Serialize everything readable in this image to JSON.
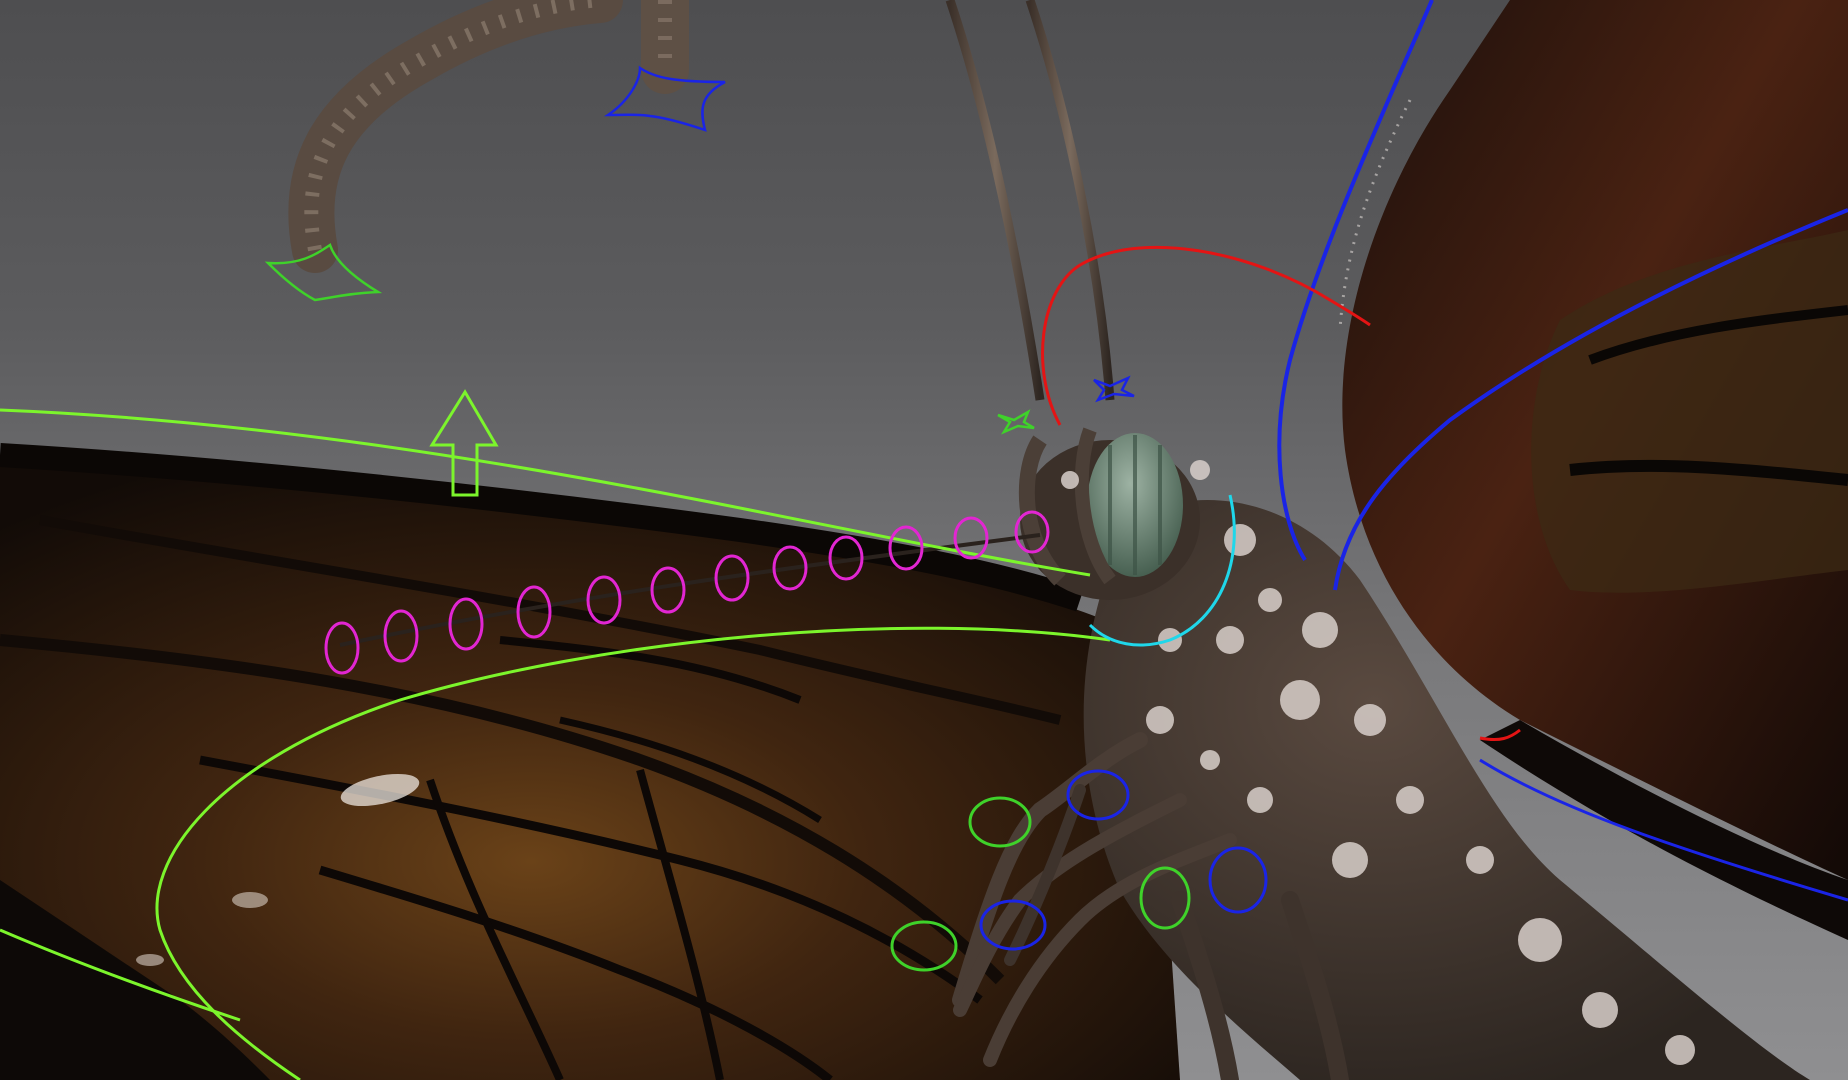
{
  "viewport": {
    "background_top": "#4e4e50",
    "background_bottom": "#8f8f91"
  },
  "colors": {
    "control_green": "#3fd22a",
    "control_lime": "#7cf52c",
    "control_blue": "#1a24e6",
    "control_red": "#e41414",
    "control_magenta": "#e226d2",
    "control_cyan": "#1fd7ea",
    "wing_dark": "#1a110b",
    "wing_orange": "#5e3812",
    "body_dark": "#3c3129",
    "body_spot": "#d8cfca",
    "eye_green": "#5f7a6a"
  },
  "controls": {
    "antenna_tip_left": "star-control",
    "antenna_tip_right": "star-control",
    "antenna_base_left": "star-control",
    "antenna_base_right": "star-control",
    "proboscis_chain": "ring-controls",
    "up_arrow": "arrow-control",
    "wing_left": "curve-control",
    "wing_right": "curve-control",
    "head": "curve-control",
    "eye": "curve-control",
    "legs": "ring-controls"
  },
  "proboscis_ring_count": 12,
  "icons": {
    "star": "star-icon",
    "ring": "ring-icon",
    "arrow": "up-arrow-icon"
  }
}
